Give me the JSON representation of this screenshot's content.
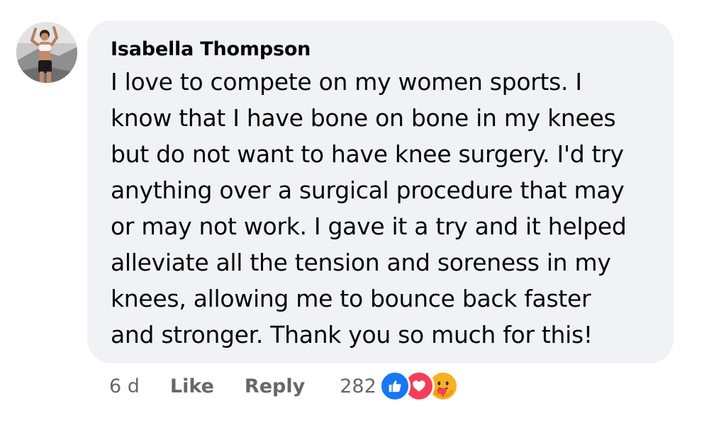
{
  "comment": {
    "author": "Isabella Thompson",
    "text": "I love to compete on my women sports. I\nknow that I have bone on bone in my knees\nbut do not want to have knee surgery. I'd try\nanything over a surgical procedure that may\nor may not work. I gave it a try and it helped\nalleviate all the tension and soreness in my\nknees, allowing me to bounce back faster\nand stronger. Thank you so much for this!",
    "time": "6 d",
    "like_label": "Like",
    "reply_label": "Reply",
    "reaction_count": "282",
    "reactions": [
      "like-icon",
      "love-icon",
      "care-icon"
    ]
  },
  "colors": {
    "bubble": "#f0f2f5",
    "text": "#050505",
    "meta": "#65676b",
    "like": "#1877f2",
    "love": "#f33e58",
    "care": "#f7b125"
  }
}
